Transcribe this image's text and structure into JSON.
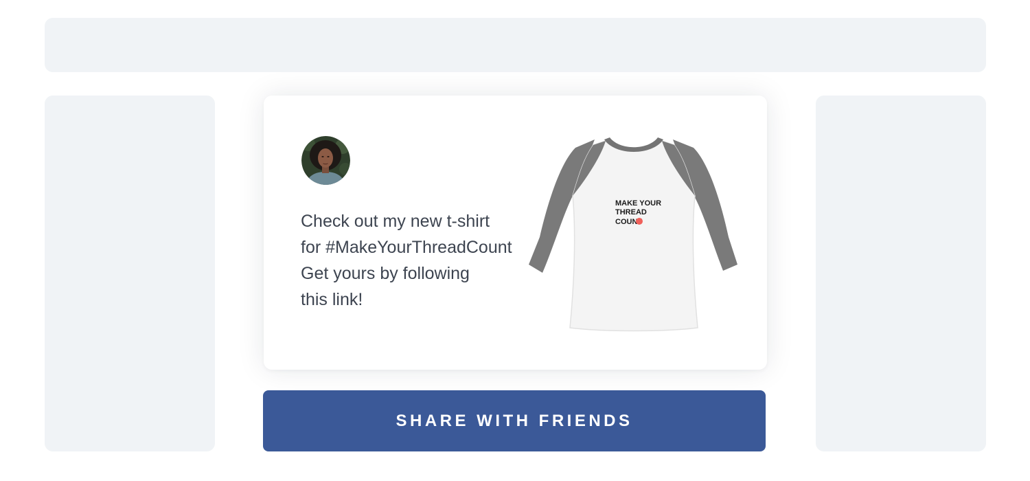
{
  "post": {
    "text_lines": [
      "Check out my new t-shirt",
      "for #MakeYourThreadCount",
      "Get yours by following",
      "this link!"
    ],
    "shirt_print": [
      "MAKE YOUR",
      "THREAD",
      "COUNT"
    ]
  },
  "share_button": {
    "label": "SHARE WITH FRIENDS"
  },
  "colors": {
    "button_bg": "#3b5998",
    "placeholder_bg": "#f0f3f6",
    "text": "#3d4450",
    "shirt_sleeve": "#7a7a7a",
    "print_dot": "#f0605a"
  }
}
